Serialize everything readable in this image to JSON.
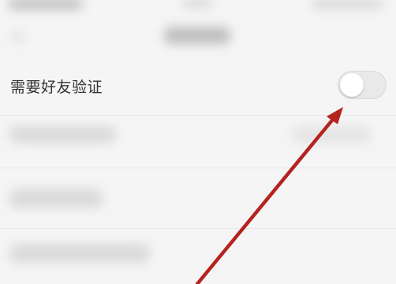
{
  "friend_verification": {
    "label": "需要好友验证",
    "enabled": false
  },
  "annotation": {
    "arrow_color": "#b5231e"
  },
  "colors": {
    "background": "#f5f5f5",
    "toggle_off": "#e9e9e9",
    "text": "#333333"
  }
}
